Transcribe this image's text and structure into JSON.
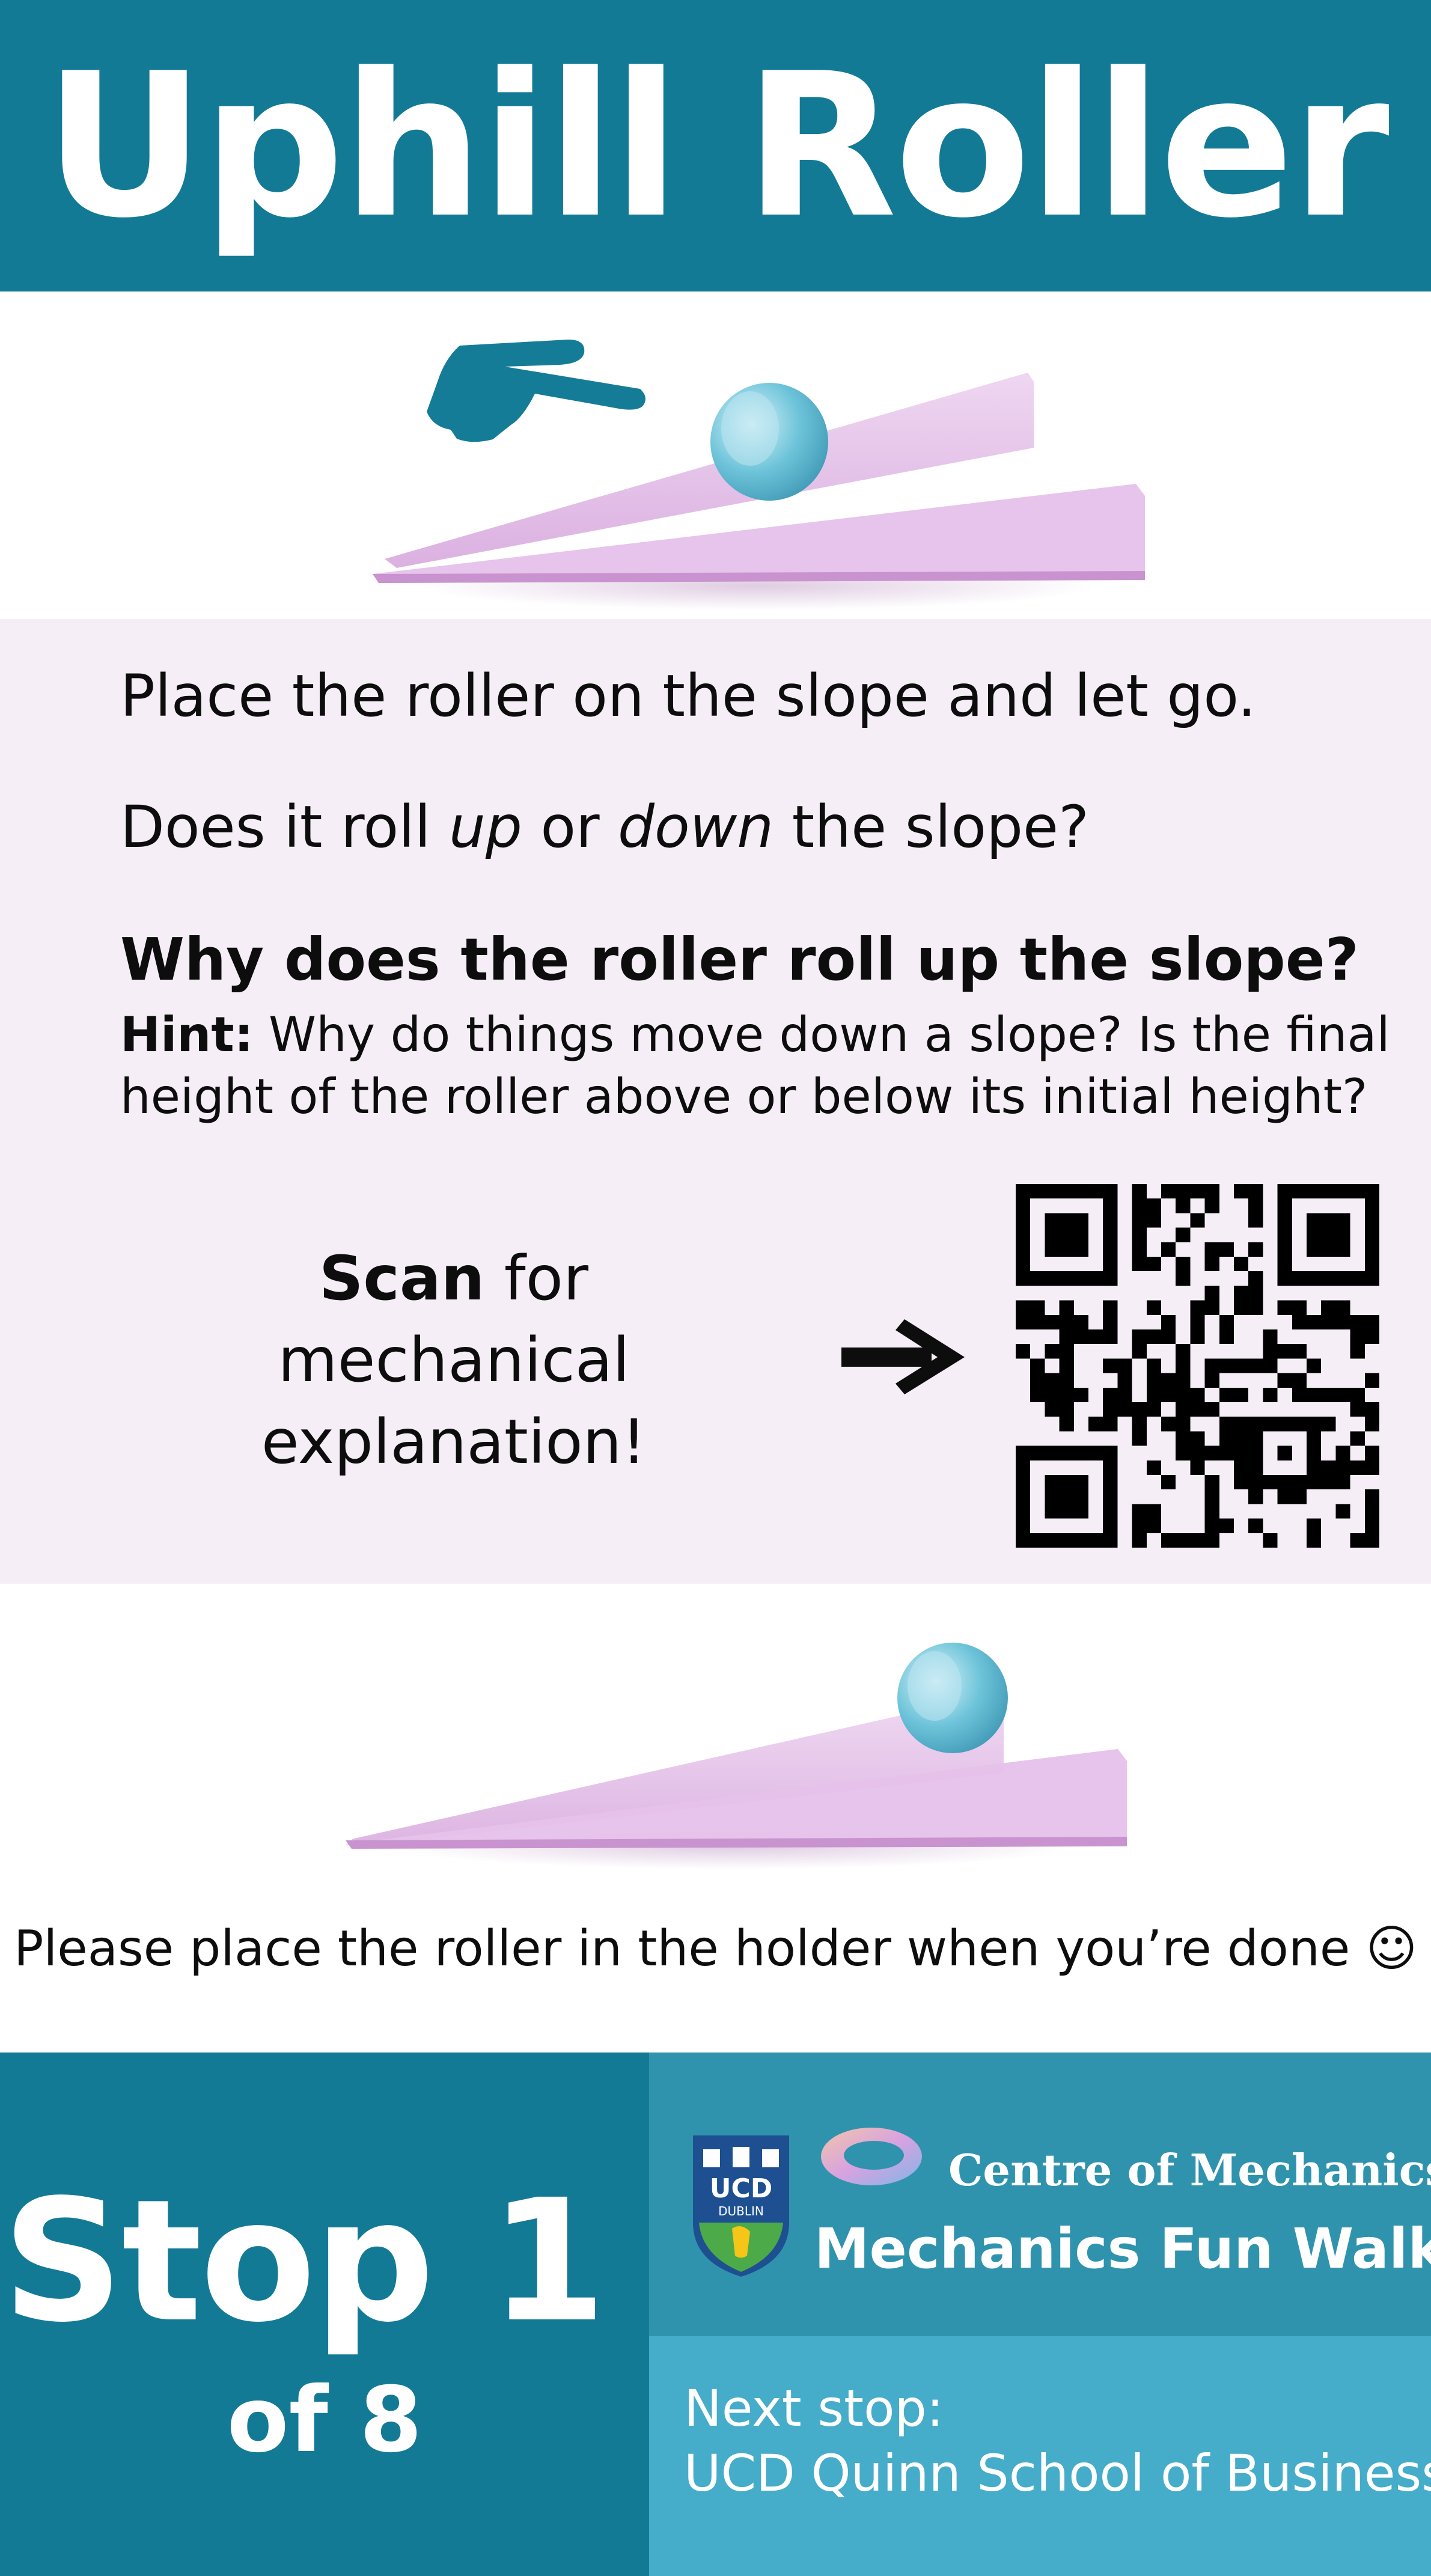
{
  "header": {
    "title": "Uphill Roller"
  },
  "instructions": {
    "line1": "Place the roller on the slope and let go.",
    "line2_part1": "Does it roll ",
    "line2_up": "up",
    "line2_mid": " or ",
    "line2_down": "down",
    "line2_end": " the slope?",
    "question": "Why does the roller roll up the slope?",
    "hint_label": "Hint:",
    "hint_line1": " Why do things move down a slope? Is the final",
    "hint_line2": "height of the roller above or below its initial height?"
  },
  "scan": {
    "bold": "Scan",
    "rest_line1": " for",
    "line2": "mechanical explanation!"
  },
  "done_text": "Please place the roller in the holder when you’re done ☺",
  "footer": {
    "stop_main": "Stop 1",
    "stop_sub": "of 8",
    "ucd_text": "UCD",
    "ucd_sub": "DUBLIN",
    "centre_name": "Centre of Mechanics",
    "walk_name": "Mechanics Fun Walk",
    "next_label": "Next stop:",
    "next_value": "UCD Quinn School of Business"
  },
  "colors": {
    "header_bg": "#137a96",
    "panel_bg": "#f6eef7",
    "footer_right_top": "#2f93ad",
    "footer_right_bottom": "#45acc9",
    "ramp": "#e2b9e6",
    "roller": "#6cc3d9"
  },
  "icons": {
    "pointing_hand": "pointing-hand-icon",
    "arrow": "right-arrow-icon",
    "qr": "qr-code",
    "ucd_logo": "ucd-crest-logo",
    "ring_logo": "centre-of-mechanics-logo"
  }
}
